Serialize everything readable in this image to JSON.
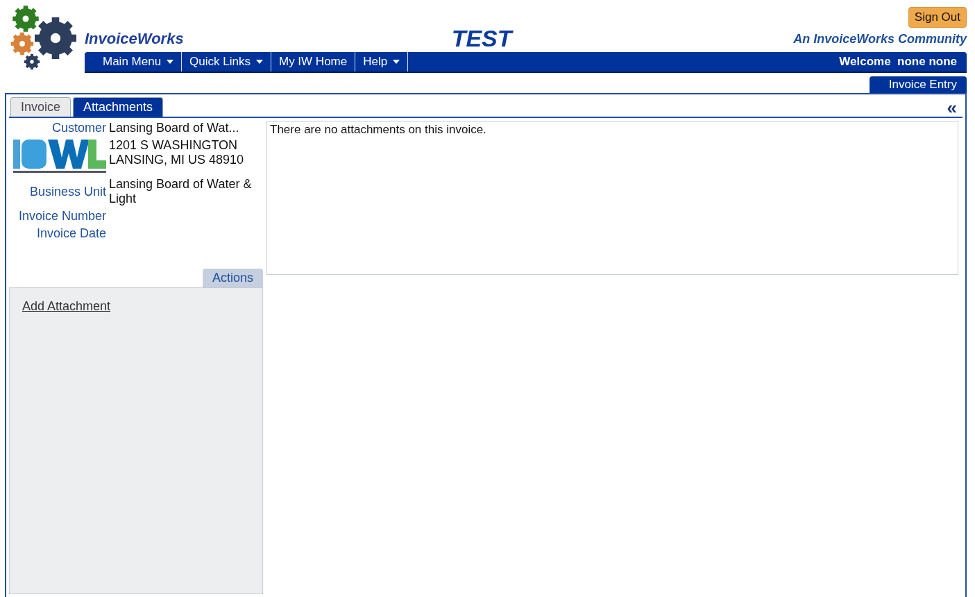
{
  "header": {
    "brand": "InvoiceWorks",
    "environment": "TEST",
    "sign_out": "Sign Out",
    "community": "An InvoiceWorks Community"
  },
  "nav": {
    "items": [
      {
        "label": "Main Menu",
        "dropdown": true
      },
      {
        "label": "Quick Links",
        "dropdown": true
      },
      {
        "label": "My IW Home",
        "dropdown": false
      },
      {
        "label": "Help",
        "dropdown": true
      }
    ],
    "welcome": "Welcome  none none"
  },
  "page_tab": "Invoice Entry",
  "tabs": [
    {
      "label": "Invoice",
      "selected": false
    },
    {
      "label": "Attachments",
      "selected": true
    }
  ],
  "collapse": "«",
  "invoice": {
    "fields": [
      {
        "label": "Customer",
        "value": "Lansing Board of Wat..."
      },
      {
        "value": "1201 S WASHINGTON\nLANSING, MI US 48910",
        "kind": "address"
      },
      {
        "label": "Business Unit",
        "value": "Lansing Board of Water & Light"
      },
      {
        "label": "Invoice Number"
      },
      {
        "label": "Invoice Date"
      }
    ]
  },
  "actions": {
    "title": "Actions",
    "links": [
      "Add Attachment"
    ]
  },
  "attachments": {
    "message": "There are no attachments on this invoice."
  }
}
